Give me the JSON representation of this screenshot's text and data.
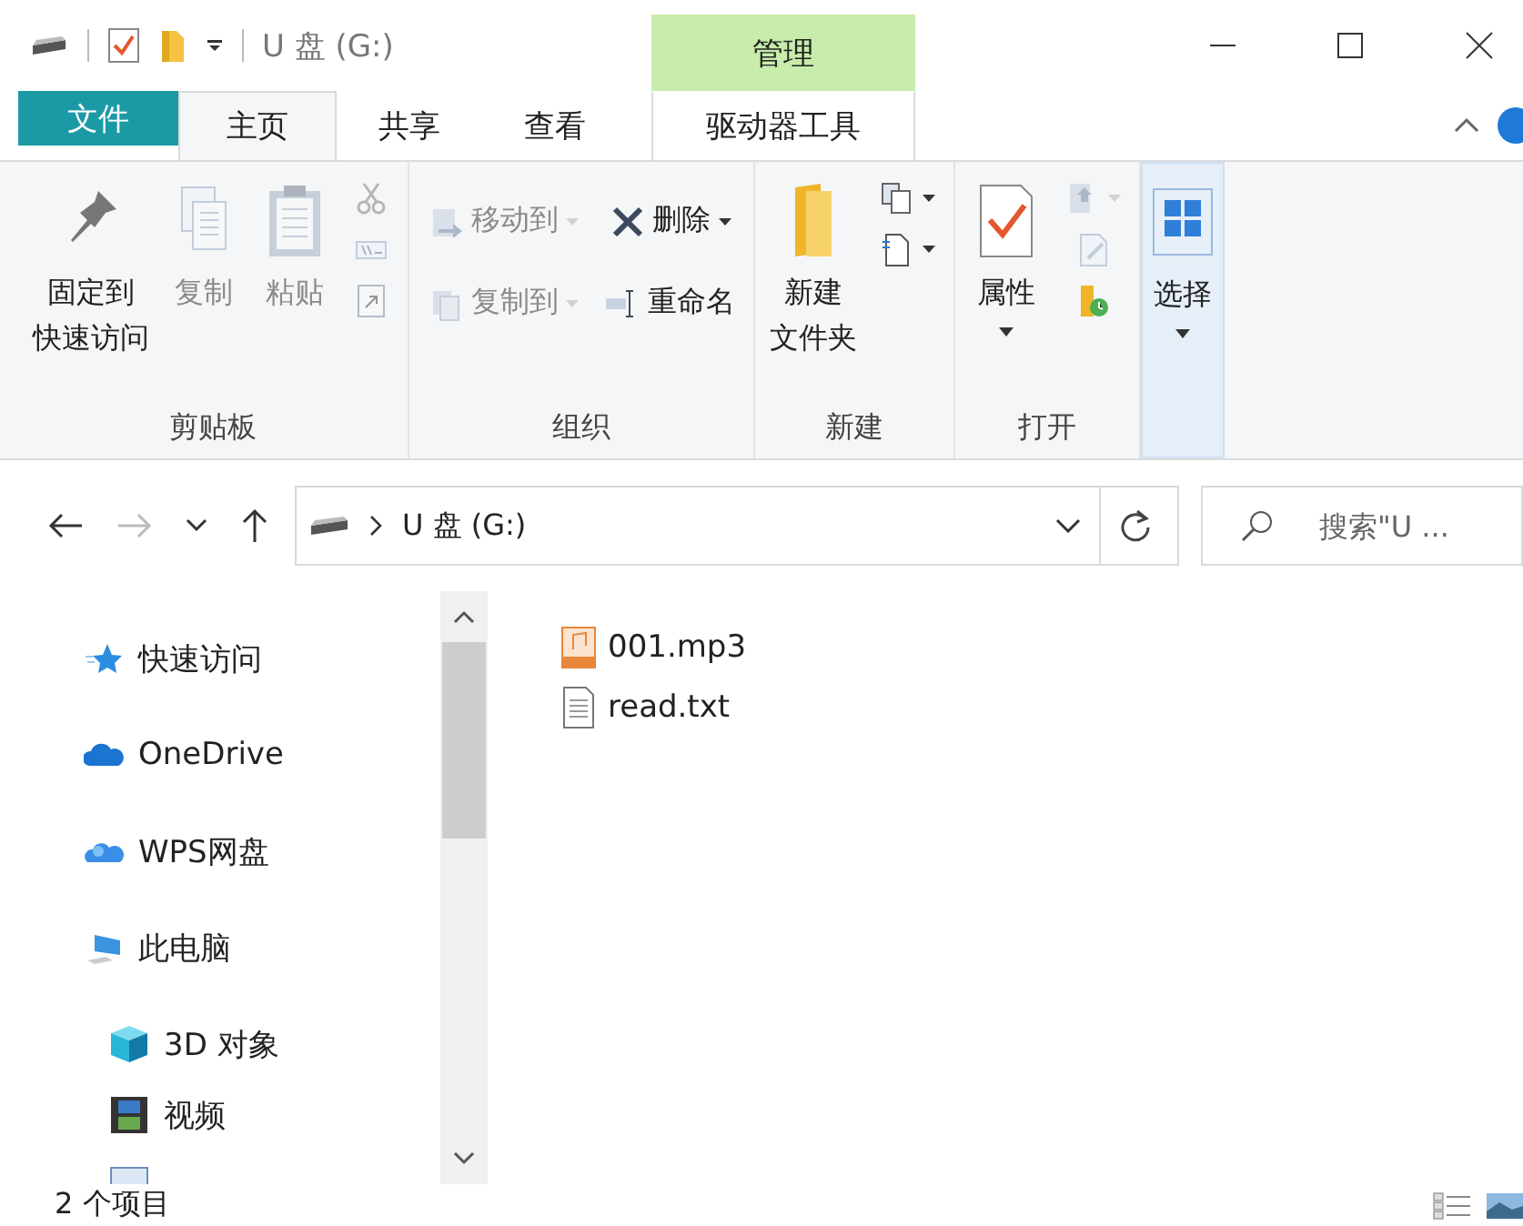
{
  "title_bar": {
    "title": "U 盘 (G:)"
  },
  "contextual_tab": {
    "label": "管理"
  },
  "tabs": [
    {
      "label": "文件",
      "kind": "file",
      "selected": false
    },
    {
      "label": "主页",
      "kind": "tab",
      "selected": true
    },
    {
      "label": "共享",
      "kind": "tab",
      "selected": false
    },
    {
      "label": "查看",
      "kind": "tab",
      "selected": false
    },
    {
      "label": "驱动器工具",
      "kind": "contextual",
      "selected": false
    }
  ],
  "ribbon": {
    "groups": [
      {
        "label": "剪贴板",
        "buttons": [
          {
            "lines": [
              "固定到",
              "快速访问"
            ],
            "kind": "large",
            "disabled": false,
            "dropdown": false
          },
          {
            "lines": [
              "复制"
            ],
            "kind": "large",
            "disabled": true,
            "dropdown": false
          },
          {
            "lines": [
              "粘贴"
            ],
            "kind": "large",
            "disabled": true,
            "dropdown": false
          },
          {
            "kind": "icon",
            "disabled": true,
            "dropdown": false
          },
          {
            "kind": "icon",
            "disabled": true,
            "dropdown": false
          },
          {
            "kind": "icon",
            "disabled": true,
            "dropdown": false
          }
        ]
      },
      {
        "label": "组织",
        "buttons": [
          {
            "label": "移动到",
            "kind": "small",
            "disabled": true,
            "dropdown": true
          },
          {
            "label": "复制到",
            "kind": "small",
            "disabled": true,
            "dropdown": true
          },
          {
            "label": "删除",
            "kind": "small",
            "disabled": false,
            "dropdown": true
          },
          {
            "label": "重命名",
            "kind": "small",
            "disabled": false,
            "dropdown": false
          }
        ]
      },
      {
        "label": "新建",
        "buttons": [
          {
            "lines": [
              "新建",
              "文件夹"
            ],
            "kind": "large",
            "disabled": false,
            "dropdown": false
          },
          {
            "kind": "icon",
            "disabled": false,
            "dropdown": true
          },
          {
            "kind": "icon",
            "disabled": false,
            "dropdown": true
          }
        ]
      },
      {
        "label": "打开",
        "buttons": [
          {
            "lines": [
              "属性"
            ],
            "kind": "large",
            "disabled": false,
            "dropdown": true
          },
          {
            "kind": "icon",
            "disabled": true,
            "dropdown": true
          },
          {
            "kind": "icon",
            "disabled": true,
            "dropdown": false
          },
          {
            "kind": "icon",
            "disabled": false,
            "dropdown": false
          }
        ]
      },
      {
        "buttons": [
          {
            "lines": [
              "选择"
            ],
            "kind": "large",
            "disabled": false,
            "dropdown": true
          }
        ]
      }
    ]
  },
  "address_bar": {
    "path": "U 盘 (G:)"
  },
  "search": {
    "placeholder": "搜索\"U ..."
  },
  "navigation_pane": {
    "items": [
      {
        "label": "快速访问"
      },
      {
        "label": "OneDrive"
      },
      {
        "label": "WPS网盘"
      },
      {
        "label": "此电脑",
        "children": [
          {
            "label": "3D 对象"
          },
          {
            "label": "视频"
          }
        ]
      }
    ]
  },
  "files": [
    {
      "name": "001.mp3",
      "kind": "audio"
    },
    {
      "name": "read.txt",
      "kind": "text"
    }
  ],
  "status_bar": {
    "text": "2 个项目"
  }
}
